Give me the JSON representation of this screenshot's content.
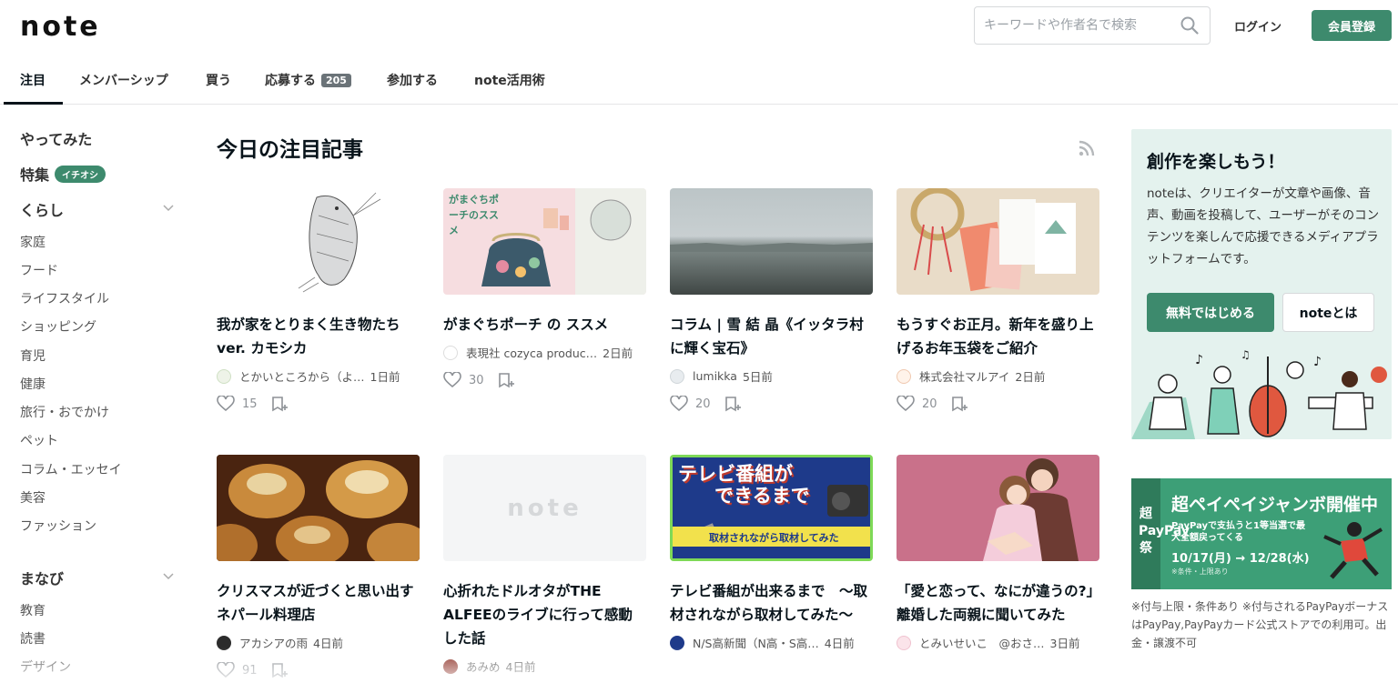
{
  "header": {
    "logo": "note",
    "search_placeholder": "キーワードや作者名で検索",
    "login": "ログイン",
    "signup": "会員登録"
  },
  "tabs": [
    {
      "label": "注目"
    },
    {
      "label": "メンバーシップ"
    },
    {
      "label": "買う"
    },
    {
      "label": "応募する",
      "badge": "205"
    },
    {
      "label": "参加する"
    },
    {
      "label": "note活用術"
    }
  ],
  "sidebar": {
    "top_items": [
      "やってみた",
      "特集"
    ],
    "feature_badge": "イチオシ",
    "sections": [
      {
        "heading": "くらし",
        "items": [
          "家庭",
          "フード",
          "ライフスタイル",
          "ショッピング",
          "育児",
          "健康",
          "旅行・おでかけ",
          "ペット",
          "コラム・エッセイ",
          "美容",
          "ファッション"
        ]
      },
      {
        "heading": "まなび",
        "items": [
          "教育",
          "読書",
          "デザイン"
        ]
      }
    ]
  },
  "main": {
    "title": "今日の注目記事",
    "cards": [
      {
        "title": "我が家をとりまく生き物たち ver. カモシカ",
        "author": "とかいところから（よ…",
        "date": "1日前",
        "likes": "15"
      },
      {
        "title": "がまぐちポーチ の ススメ",
        "author": "表現社 cozyca produc…",
        "date": "2日前",
        "likes": "30"
      },
      {
        "title": "コラム | 雪 結 晶《イッタラ村に輝く宝石》",
        "author": "lumikka",
        "date": "5日前",
        "likes": "20"
      },
      {
        "title": "もうすぐお正月。新年を盛り上げるお年玉袋をご紹介",
        "author": "株式会社マルアイ",
        "date": "2日前",
        "likes": "20"
      },
      {
        "title": "クリスマスが近づくと思い出すネパール料理店",
        "author": "アカシアの雨",
        "date": "4日前",
        "likes": "91"
      },
      {
        "title": "心折れたドルオタがTHE ALFEEのライブに行って感動した話",
        "author": "あみめ",
        "date": "4日前",
        "likes": ""
      },
      {
        "title": "テレビ番組が出来るまで　～取材されながら取材してみた～",
        "author": "N/S高新聞（N高・S高…",
        "date": "4日前",
        "likes": ""
      },
      {
        "title": "「愛と恋って、なにが違うの?」離婚した両親に聞いてみた",
        "author": "とみいせいこ　@おさ…",
        "date": "3日前",
        "likes": ""
      }
    ],
    "thumb_texts": {
      "gamaguchi": "がまぐちポーチのススメ",
      "placeholder_logo": "note",
      "tv_line1": "テレビ番組が",
      "tv_line2": "できるまで",
      "tv_line3": "取材されながら取材してみた"
    }
  },
  "promo": {
    "title": "創作を楽しもう！",
    "text": "noteは、クリエイターが文章や画像、音声、動画を投稿して、ユーザーがそのコンテンツを楽しんで応援できるメディアプラットフォームです。",
    "btn_start": "無料ではじめる",
    "btn_about": "noteとは"
  },
  "banner": {
    "side_text": "超PayPay祭",
    "title": "超ペイペイジャンボ開催中",
    "sub": "PayPayで支払うと1等当選で最大全額戻ってくる",
    "dates": "10/17(月) → 12/28(水)",
    "note": "※条件・上限あり",
    "footnote": "※付与上限・条件あり ※付与されるPayPayボーナスはPayPay,PayPayカード公式ストアでの利用可。出金・譲渡不可"
  },
  "colors": {
    "accent": "#3d8a6d",
    "promo_bg": "#e4f2ee",
    "banner": "#3d9f77"
  }
}
